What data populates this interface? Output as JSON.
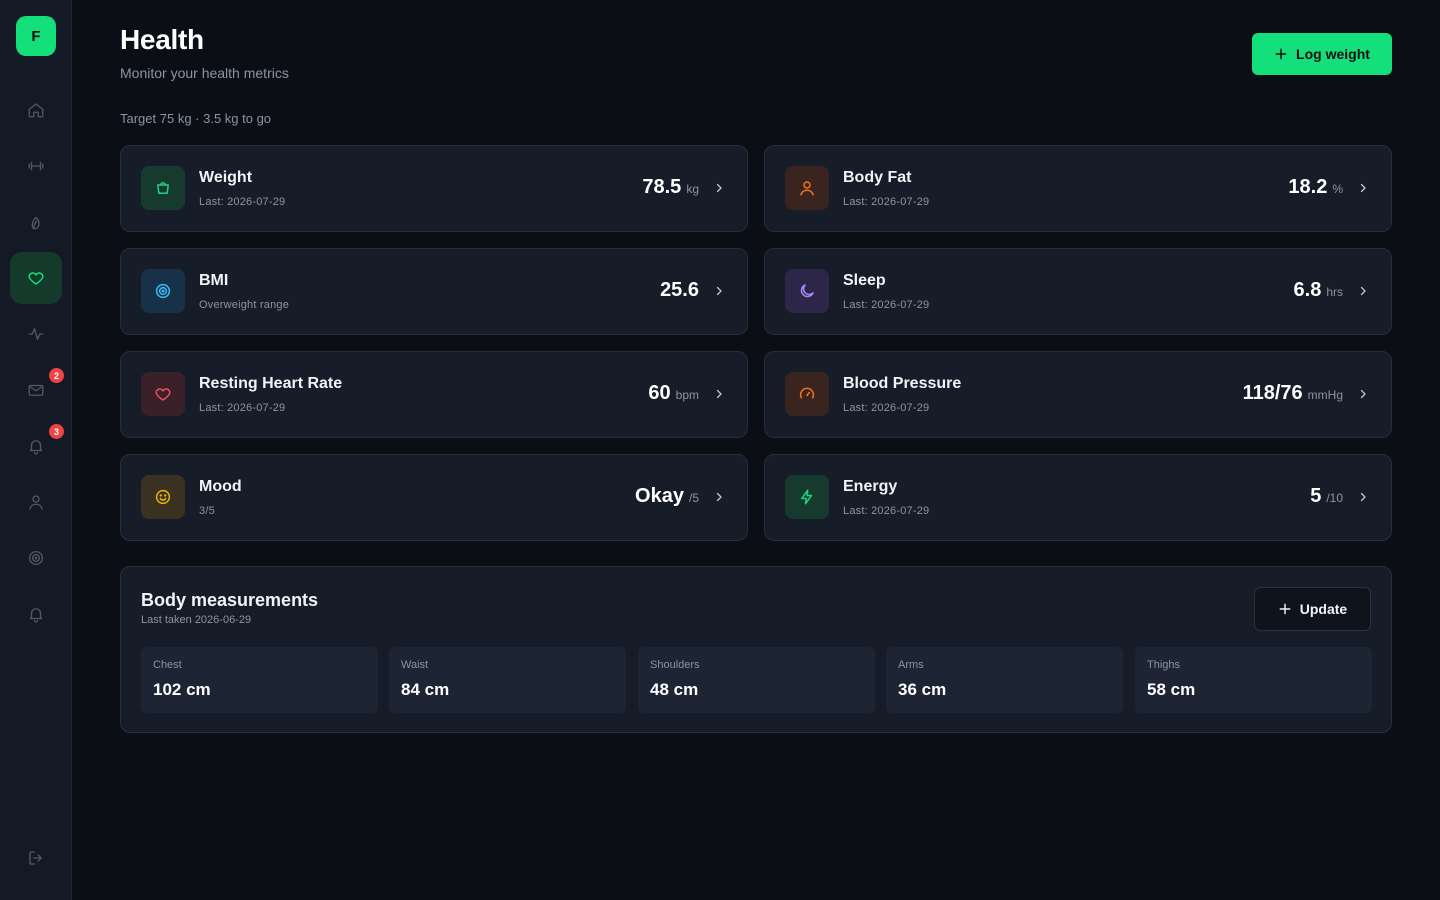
{
  "app": {
    "logo_letter": "F",
    "accent": "#13e07a"
  },
  "sidebar": {
    "items": [
      {
        "icon": "home-icon",
        "active": false
      },
      {
        "icon": "dumbbell-icon",
        "active": false
      },
      {
        "icon": "leaf-icon",
        "active": false
      },
      {
        "icon": "heart-icon",
        "active": true
      },
      {
        "icon": "activity-icon",
        "active": false
      },
      {
        "icon": "mail-icon",
        "active": false,
        "badge": "2"
      },
      {
        "icon": "bell-icon",
        "active": false,
        "badge": "3"
      },
      {
        "icon": "user-icon",
        "active": false
      },
      {
        "icon": "target-icon",
        "active": false
      },
      {
        "icon": "bell-icon",
        "active": false
      }
    ],
    "logout_icon": "logout-icon"
  },
  "header": {
    "title": "Health",
    "subtitle": "Monitor your health metrics",
    "log_button_label": "Log weight",
    "target_text": "Target 75 kg · 3.5 kg to go"
  },
  "metrics": [
    {
      "name": "Weight",
      "sub": "Last: 2026-07-29",
      "value": "78.5",
      "unit": "kg",
      "icon": "scale-icon",
      "color": "#1fd07c"
    },
    {
      "name": "Body Fat",
      "sub": "Last: 2026-07-29",
      "value": "18.2",
      "unit": "%",
      "icon": "user-icon",
      "color": "#f97316"
    },
    {
      "name": "BMI",
      "sub": "Overweight range",
      "value": "25.6",
      "unit": "",
      "icon": "target-icon",
      "color": "#38bdf8"
    },
    {
      "name": "Sleep",
      "sub": "Last: 2026-07-29",
      "value": "6.8",
      "unit": "hrs",
      "icon": "moon-icon",
      "color": "#a78bfa"
    },
    {
      "name": "Resting Heart Rate",
      "sub": "Last: 2026-07-29",
      "value": "60",
      "unit": "bpm",
      "icon": "heart-icon",
      "color": "#f05060"
    },
    {
      "name": "Blood Pressure",
      "sub": "Last: 2026-07-29",
      "value": "118/76",
      "unit": "mmHg",
      "icon": "gauge-icon",
      "color": "#f97316"
    },
    {
      "name": "Mood",
      "sub": "3/5",
      "value": "Okay",
      "unit": "/5",
      "icon": "smile-icon",
      "color": "#eab308"
    },
    {
      "name": "Energy",
      "sub": "Last: 2026-07-29",
      "value": "5",
      "unit": "/10",
      "icon": "bolt-icon",
      "color": "#1fd07c"
    }
  ],
  "measurements": {
    "title": "Body measurements",
    "subtitle": "Last taken 2026-06-29",
    "update_label": "Update",
    "items": [
      {
        "label": "Chest",
        "value": "102 cm"
      },
      {
        "label": "Waist",
        "value": "84 cm"
      },
      {
        "label": "Shoulders",
        "value": "48 cm"
      },
      {
        "label": "Arms",
        "value": "36 cm"
      },
      {
        "label": "Thighs",
        "value": "58 cm"
      }
    ]
  }
}
